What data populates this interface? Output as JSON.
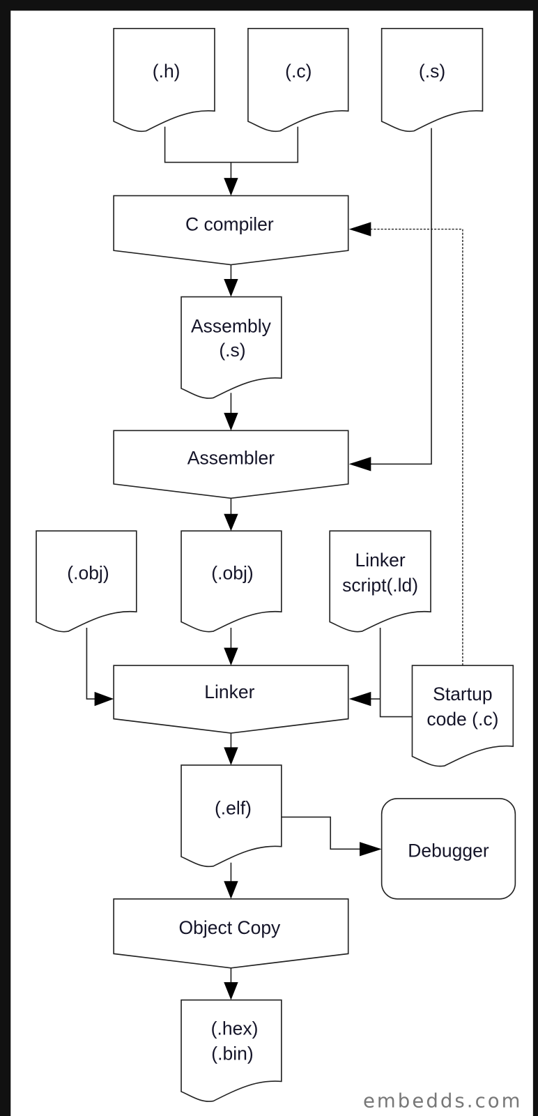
{
  "diagram": {
    "nodes": {
      "h_file": "(.h)",
      "c_file": "(.c)",
      "s_file": "(.s)",
      "c_compiler": "C compiler",
      "assembly": [
        "Assembly",
        "(.s)"
      ],
      "assembler": "Assembler",
      "obj_left": "(.obj)",
      "obj_mid": "(.obj)",
      "linker_script": [
        "Linker",
        "script(.ld)"
      ],
      "linker": "Linker",
      "startup_code": [
        "Startup",
        "code (.c)"
      ],
      "elf": "(.elf)",
      "debugger": "Debugger",
      "object_copy": "Object Copy",
      "output": [
        "(.hex)",
        "(.bin)"
      ]
    },
    "edges": [
      {
        "from": "(.h)",
        "to": "C compiler"
      },
      {
        "from": "(.c)",
        "to": "C compiler"
      },
      {
        "from": "C compiler",
        "to": "Assembly (.s)"
      },
      {
        "from": "Assembly (.s)",
        "to": "Assembler"
      },
      {
        "from": "(.s)",
        "to": "Assembler"
      },
      {
        "from": "Assembler",
        "to": "(.obj)"
      },
      {
        "from": "(.obj)",
        "to": "Linker"
      },
      {
        "from": "Linker script(.ld)",
        "to": "Linker"
      },
      {
        "from": "Startup code (.c)",
        "to": "Linker"
      },
      {
        "from": "Startup code (.c)",
        "to": "C compiler",
        "style": "dashed"
      },
      {
        "from": "Linker",
        "to": "(.elf)"
      },
      {
        "from": "(.elf)",
        "to": "Debugger"
      },
      {
        "from": "(.elf)",
        "to": "Object Copy"
      },
      {
        "from": "Object Copy",
        "to": "(.hex) (.bin)"
      }
    ],
    "watermark": "embedds.com"
  }
}
